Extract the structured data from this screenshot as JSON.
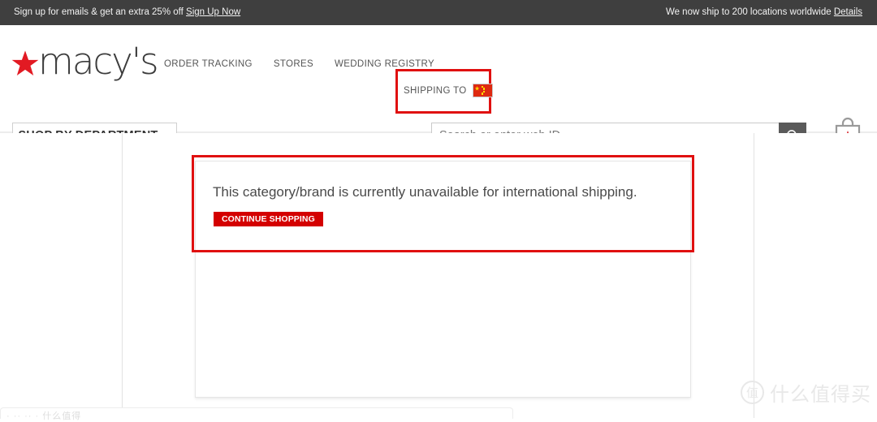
{
  "promo": {
    "left_text": "Sign up for emails & get an extra 25% off ",
    "left_link": "Sign Up Now",
    "right_text": "We now ship to 200 locations worldwide ",
    "right_link": "Details"
  },
  "header": {
    "logo_text": "macy's",
    "logo_star_icon": "star-icon",
    "nav": [
      {
        "label": "ORDER TRACKING"
      },
      {
        "label": "STORES"
      },
      {
        "label": "WEDDING REGISTRY"
      }
    ],
    "shipping_to": {
      "label": "SHIPPING TO",
      "flag_icon": "china-flag-icon",
      "highlight_color": "#e01010"
    },
    "shop_by_department": {
      "label": "SHOP BY DEPARTMENT",
      "caret": "▼"
    },
    "search": {
      "placeholder": "Search or enter web ID",
      "value": "",
      "button_icon": "search-icon"
    },
    "bag": {
      "icon": "shopping-bag-star-icon"
    }
  },
  "main": {
    "message": "This category/brand is currently unavailable for international shipping.",
    "continue_button": "CONTINUE SHOPPING",
    "highlight_color": "#e01010",
    "button_color": "#d40000"
  },
  "footer": {
    "faint_text": "·  ··       ··     ·            什么值得"
  },
  "watermark": {
    "mark": "值",
    "text": "什么值得买"
  }
}
